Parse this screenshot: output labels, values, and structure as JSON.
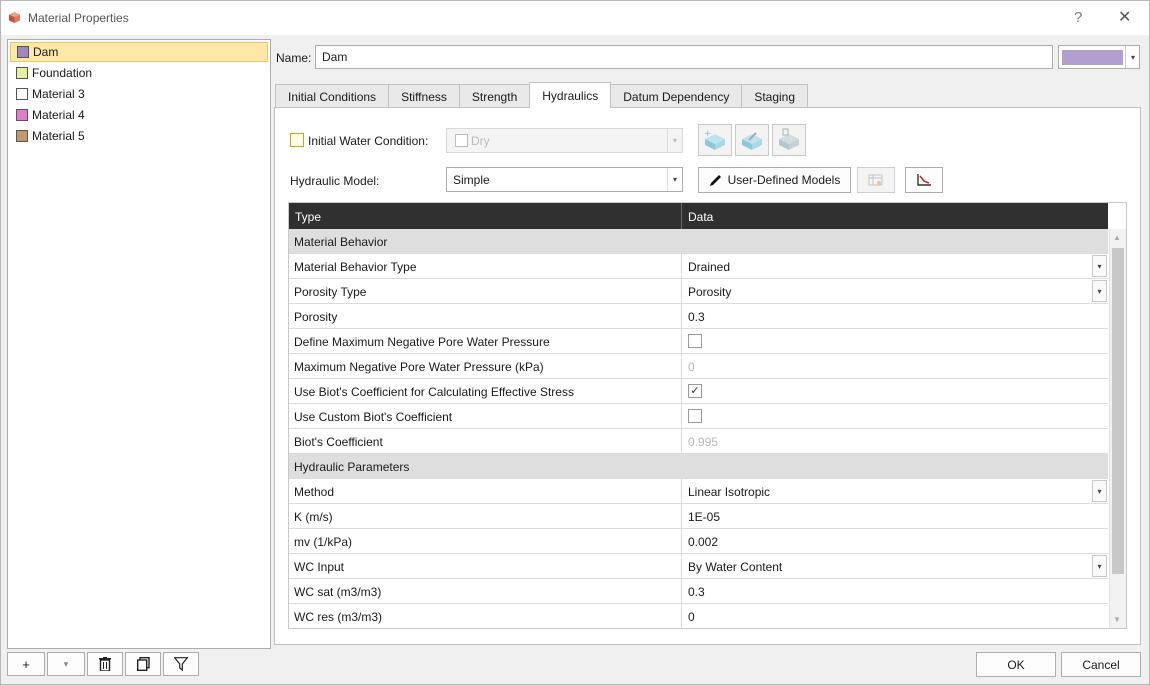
{
  "window": {
    "title": "Material Properties",
    "help_glyph": "?",
    "close_glyph": "✕"
  },
  "materials": [
    {
      "name": "Dam",
      "color": "#9f87bf",
      "selected": true
    },
    {
      "name": "Foundation",
      "color": "#e6f0a0",
      "selected": false
    },
    {
      "name": "Material 3",
      "color": "#ffffff",
      "selected": false
    },
    {
      "name": "Material 4",
      "color": "#e27ec9",
      "selected": false
    },
    {
      "name": "Material 5",
      "color": "#c39a6b",
      "selected": false
    }
  ],
  "list_toolbar": {
    "add_glyph": "+",
    "dropdown_glyph": "▾"
  },
  "name_field": {
    "label": "Name:",
    "value": "Dam",
    "color": "#b39ed0"
  },
  "tabs": [
    {
      "label": "Initial Conditions",
      "active": false
    },
    {
      "label": "Stiffness",
      "active": false
    },
    {
      "label": "Strength",
      "active": false
    },
    {
      "label": "Hydraulics",
      "active": true
    },
    {
      "label": "Datum Dependency",
      "active": false
    },
    {
      "label": "Staging",
      "active": false
    }
  ],
  "hydraulics": {
    "initial_water_condition": {
      "label": "Initial Water Condition:",
      "checked": false,
      "value": "Dry"
    },
    "hydraulic_model": {
      "label": "Hydraulic Model:",
      "value": "Simple"
    },
    "user_defined_models_label": "User-Defined Models",
    "grid": {
      "header_type": "Type",
      "header_data": "Data",
      "rows": [
        {
          "kind": "section",
          "label": "Material Behavior"
        },
        {
          "kind": "dropdown",
          "label": "Material Behavior Type",
          "value": "Drained"
        },
        {
          "kind": "dropdown",
          "label": "Porosity Type",
          "value": "Porosity"
        },
        {
          "kind": "text",
          "label": "Porosity",
          "value": "0.3"
        },
        {
          "kind": "checkbox",
          "label": "Define Maximum Negative Pore Water Pressure",
          "checked": false
        },
        {
          "kind": "disabled",
          "label": "Maximum Negative Pore Water Pressure (kPa)",
          "value": "0"
        },
        {
          "kind": "checkbox",
          "label": "Use Biot's Coefficient for Calculating Effective Stress",
          "checked": true
        },
        {
          "kind": "checkbox",
          "label": "Use Custom Biot's Coefficient",
          "checked": false
        },
        {
          "kind": "disabled",
          "label": "Biot's Coefficient",
          "value": "0.995"
        },
        {
          "kind": "section",
          "label": "Hydraulic Parameters"
        },
        {
          "kind": "dropdown",
          "label": "Method",
          "value": "Linear Isotropic"
        },
        {
          "kind": "text",
          "label": "K (m/s)",
          "value": "1E-05"
        },
        {
          "kind": "text",
          "label": "mv (1/kPa)",
          "value": "0.002"
        },
        {
          "kind": "dropdown",
          "label": "WC Input",
          "value": "By Water Content"
        },
        {
          "kind": "text",
          "label": "WC sat (m3/m3)",
          "value": "0.3"
        },
        {
          "kind": "text",
          "label": "WC res (m3/m3)",
          "value": "0"
        }
      ]
    }
  },
  "footer": {
    "ok_label": "OK",
    "cancel_label": "Cancel"
  }
}
